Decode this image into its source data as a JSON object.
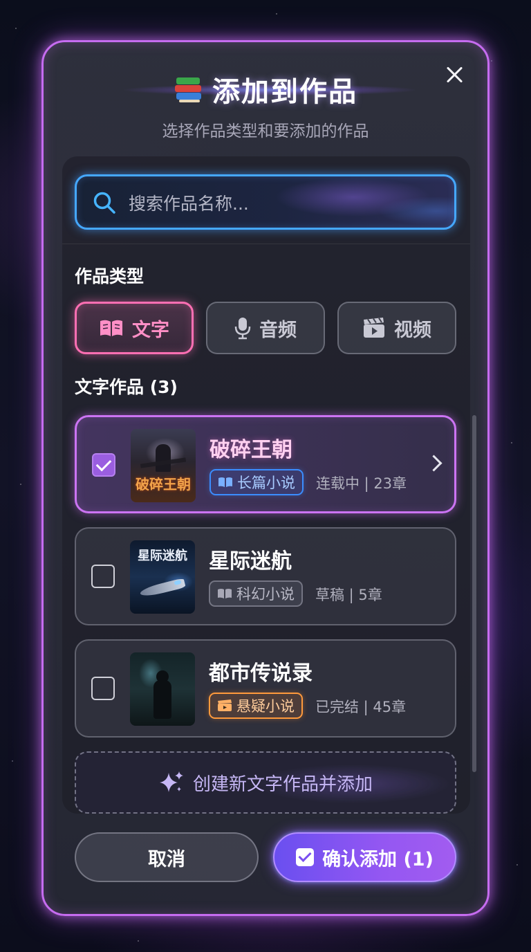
{
  "dialog": {
    "title": "添加到作品",
    "subtitle": "选择作品类型和要添加的作品",
    "close_icon": "close-icon",
    "title_icon": "books-icon"
  },
  "search": {
    "placeholder": "搜索作品名称...",
    "value": "",
    "icon": "search-icon"
  },
  "type_section": {
    "label": "作品类型",
    "types": [
      {
        "label": "文字",
        "icon": "book-open-icon",
        "active": true
      },
      {
        "label": "音频",
        "icon": "microphone-icon",
        "active": false
      },
      {
        "label": "视频",
        "icon": "clapperboard-icon",
        "active": false
      }
    ]
  },
  "works_section": {
    "label": "文字作品 (3)",
    "items": [
      {
        "title": "破碎王朝",
        "cover_text": "破碎王朝",
        "tag": "长篇小说",
        "tag_icon": "book-icon",
        "tag_color": "#3b8dff",
        "meta": "连载中 | 23章",
        "checked": true,
        "expand_icon": "chevron-right-icon"
      },
      {
        "title": "星际迷航",
        "cover_text": "星际迷航",
        "tag": "科幻小说",
        "tag_icon": "book-icon",
        "tag_color": "#9a9aa8",
        "meta": "草稿 | 5章",
        "checked": false
      },
      {
        "title": "都市传说录",
        "tag": "悬疑小说",
        "tag_icon": "clapperboard-icon",
        "tag_color": "#ff9a3c",
        "meta": "已完结 | 45章",
        "checked": false
      }
    ],
    "create_label": "创建新文字作品并添加",
    "create_icon": "sparkle-icon"
  },
  "footer": {
    "cancel_label": "取消",
    "confirm_label": "确认添加 (1)",
    "confirm_icon": "checkbox-checked-icon"
  },
  "colors": {
    "accent_purple": "#cc74f3",
    "accent_pink": "#ff6fb3",
    "search_border": "#45a8ff",
    "confirm_gradient_start": "#6a4ff0",
    "confirm_gradient_end": "#a25cf0"
  }
}
